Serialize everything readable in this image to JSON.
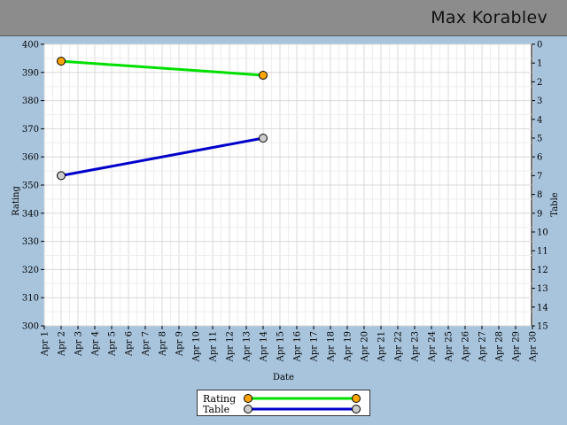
{
  "header": {
    "title": "Max Korablev"
  },
  "colors": {
    "rating": "#00e000",
    "table": "#0000cc",
    "rating_marker": "#ffa500",
    "table_marker": "#cccccc",
    "background": "#a8c4dd",
    "header": "#8c8c8c"
  },
  "chart_data": {
    "type": "line",
    "xlabel": "Date",
    "ylabel": "Rating",
    "y2label": "Table",
    "x_ticks": [
      "Apr 1",
      "Apr 2",
      "Apr 3",
      "Apr 4",
      "Apr 5",
      "Apr 6",
      "Apr 7",
      "Apr 8",
      "Apr 9",
      "Apr 10",
      "Apr 11",
      "Apr 12",
      "Apr 13",
      "Apr 14",
      "Apr 15",
      "Apr 16",
      "Apr 17",
      "Apr 18",
      "Apr 19",
      "Apr 20",
      "Apr 21",
      "Apr 22",
      "Apr 23",
      "Apr 24",
      "Apr 25",
      "Apr 26",
      "Apr 27",
      "Apr 28",
      "Apr 29",
      "Apr 30"
    ],
    "xlim": [
      1,
      30
    ],
    "ylim": [
      300,
      400
    ],
    "y_ticks": [
      300,
      310,
      320,
      330,
      340,
      350,
      360,
      370,
      380,
      390,
      400
    ],
    "y2lim": [
      15,
      0
    ],
    "y2_ticks": [
      0,
      1,
      2,
      3,
      4,
      5,
      6,
      7,
      8,
      9,
      10,
      11,
      12,
      13,
      14,
      15
    ],
    "grid": true,
    "legend_position": "bottom",
    "series": [
      {
        "name": "Rating",
        "axis": "left",
        "x": [
          2,
          14
        ],
        "values": [
          394,
          389
        ]
      },
      {
        "name": "Table",
        "axis": "right",
        "x": [
          2,
          14
        ],
        "values": [
          7,
          5
        ]
      }
    ]
  }
}
